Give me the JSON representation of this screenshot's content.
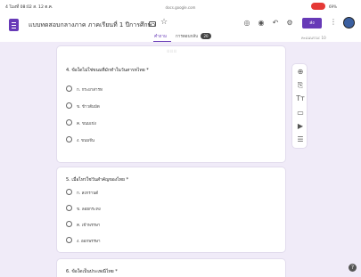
{
  "statusbar": {
    "time": "4 โมงที่ 08:02 ส. 12 ต.ค.",
    "url": "docs.google.com",
    "battery": "69%"
  },
  "appbar": {
    "title": "แบบทดสอบกลางภาค ภาคเรียนที่ 1 ปีการศึกษา",
    "send_label": "ส่ง"
  },
  "tabs": {
    "questions": "คำถาม",
    "responses": "การตอบกลับ",
    "responses_count": "20",
    "total_points": "คะแนนรวม: 10"
  },
  "questions": [
    {
      "title": "4. ข้อใดไม่ใช่ขนมที่มักทำในวันสารทไทย *",
      "options": [
        "ก. กระยาสารท",
        "ข. ข้าวต้มมัด",
        "ค. ขนมเข่ง",
        "ง. ขนมจีน"
      ]
    },
    {
      "title": "5. เมื่อไหร่ใช่วันสำคัญของไทย *",
      "options": [
        "ก. สงกรานต์",
        "ข. ลอยกระทง",
        "ค. เข้าพรรษา",
        "ง. ออกพรรษา"
      ]
    },
    {
      "title": "6. ข้อใดเป็นประเพณีไทย *",
      "options": []
    }
  ],
  "side_toolbar": {
    "icons": [
      "add-question-icon",
      "import-questions-icon",
      "add-title-icon",
      "add-image-icon",
      "add-video-icon",
      "add-section-icon"
    ]
  }
}
